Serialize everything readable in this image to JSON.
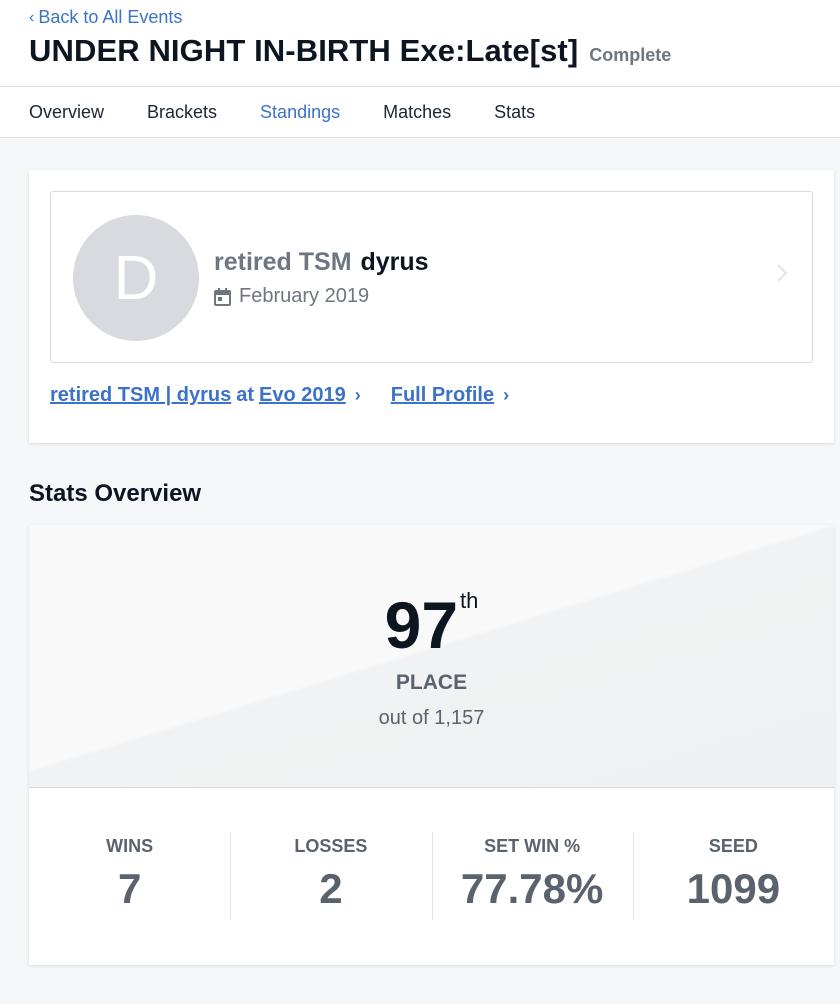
{
  "header": {
    "back_label": "Back to All Events",
    "event_title": "UNDER NIGHT IN-BIRTH Exe:Late[st]",
    "status": "Complete"
  },
  "tabs": [
    {
      "label": "Overview",
      "active": false
    },
    {
      "label": "Brackets",
      "active": false
    },
    {
      "label": "Standings",
      "active": true
    },
    {
      "label": "Matches",
      "active": false
    },
    {
      "label": "Stats",
      "active": false
    }
  ],
  "profile": {
    "avatar_letter": "D",
    "prefix": "retired TSM",
    "tag": "dyrus",
    "date": "February 2019",
    "event_link": {
      "player": "retired TSM | dyrus",
      "connector": "at",
      "event": "Evo 2019"
    },
    "full_profile_label": "Full Profile"
  },
  "stats_overview": {
    "section_title": "Stats Overview",
    "placement": {
      "value": "97",
      "suffix": "th",
      "label": "PLACE",
      "total": "out of 1,157"
    },
    "stats": [
      {
        "label": "WINS",
        "value": "7"
      },
      {
        "label": "LOSSES",
        "value": "2"
      },
      {
        "label": "SET WIN %",
        "value": "77.78%"
      },
      {
        "label": "SEED",
        "value": "1099"
      }
    ]
  },
  "colors": {
    "accent": "#3b73c8",
    "title": "#0d1521",
    "muted": "#6e7681"
  }
}
